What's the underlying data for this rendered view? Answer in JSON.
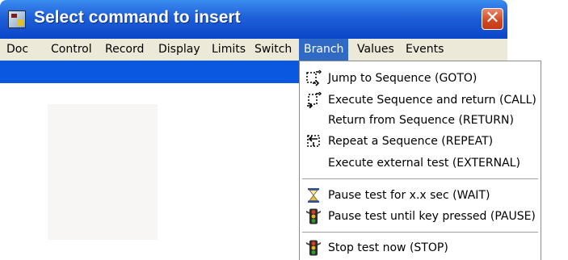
{
  "window": {
    "title": "Select command to insert",
    "close_glyph": "✕"
  },
  "menubar": [
    "Doc",
    "Control",
    "Record",
    "Display",
    "Limits",
    "Switch",
    "Branch",
    "Values",
    "Events"
  ],
  "active_menu": "Branch",
  "dropdown": {
    "items": [
      {
        "label": "Jump to Sequence (GOTO)",
        "icon": "jump-icon"
      },
      {
        "label": "Execute Sequence and return (CALL)",
        "icon": "call-icon"
      },
      {
        "label": "Return from Sequence (RETURN)",
        "icon": ""
      },
      {
        "label": "Repeat a Sequence (REPEAT)",
        "icon": "repeat-icon"
      },
      {
        "label": "Execute external test (EXTERNAL)",
        "icon": ""
      },
      {
        "label": "Pause test for x.x sec (WAIT)",
        "icon": "hourglass-icon"
      },
      {
        "label": "Pause test until key pressed (PAUSE)",
        "icon": "traffic-light-icon"
      },
      {
        "label": "Stop test now (STOP)",
        "icon": "traffic-light-icon"
      }
    ]
  },
  "colors": {
    "titlebar": "#0a46c8",
    "menubar": "#ece9d8",
    "highlight": "#316ac5",
    "strip": "#0a58e0"
  }
}
